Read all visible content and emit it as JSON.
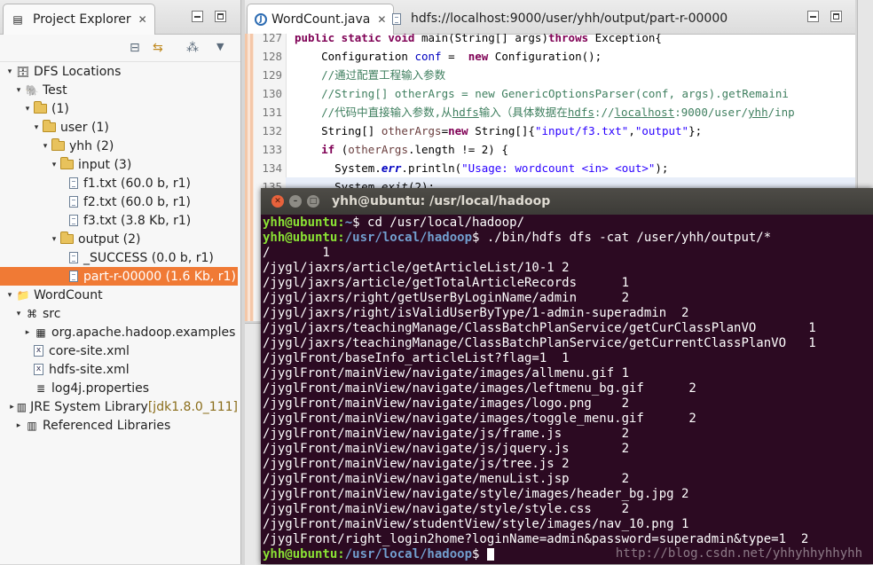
{
  "explorer": {
    "tab_title": "Project Explorer",
    "close_glyph": "✕",
    "tree": [
      {
        "label": "DFS Locations",
        "extra": "",
        "indent": 0,
        "twisty": "▾",
        "icon": "dfs-icon",
        "selected": false
      },
      {
        "label": "Test",
        "extra": "",
        "indent": 1,
        "twisty": "▾",
        "icon": "elephant-icon",
        "selected": false
      },
      {
        "label": "(1)",
        "extra": "",
        "indent": 2,
        "twisty": "▾",
        "icon": "folder-icon",
        "selected": false
      },
      {
        "label": "user (1)",
        "extra": "",
        "indent": 3,
        "twisty": "▾",
        "icon": "folder-icon",
        "selected": false
      },
      {
        "label": "yhh (2)",
        "extra": "",
        "indent": 4,
        "twisty": "▾",
        "icon": "folder-icon",
        "selected": false
      },
      {
        "label": "input (3)",
        "extra": "",
        "indent": 5,
        "twisty": "▾",
        "icon": "folder-icon",
        "selected": false
      },
      {
        "label": "f1.txt (60.0 b, r1)",
        "extra": "",
        "indent": 6,
        "twisty": "",
        "icon": "file-icon",
        "selected": false
      },
      {
        "label": "f2.txt (60.0 b, r1)",
        "extra": "",
        "indent": 6,
        "twisty": "",
        "icon": "file-icon",
        "selected": false
      },
      {
        "label": "f3.txt (3.8 Kb, r1)",
        "extra": "",
        "indent": 6,
        "twisty": "",
        "icon": "file-icon",
        "selected": false
      },
      {
        "label": "output (2)",
        "extra": "",
        "indent": 5,
        "twisty": "▾",
        "icon": "folder-icon",
        "selected": false
      },
      {
        "label": "_SUCCESS (0.0 b, r1)",
        "extra": "",
        "indent": 6,
        "twisty": "",
        "icon": "file-icon",
        "selected": false
      },
      {
        "label": "part-r-00000 (1.6 Kb, r1)",
        "extra": "",
        "indent": 6,
        "twisty": "",
        "icon": "file-icon",
        "selected": true
      },
      {
        "label": "WordCount",
        "extra": "",
        "indent": 0,
        "twisty": "▾",
        "icon": "project-icon",
        "selected": false
      },
      {
        "label": "src",
        "extra": "",
        "indent": 1,
        "twisty": "▾",
        "icon": "source-folder-icon",
        "selected": false
      },
      {
        "label": "org.apache.hadoop.examples",
        "extra": "",
        "indent": 2,
        "twisty": "▸",
        "icon": "package-icon",
        "selected": false
      },
      {
        "label": "core-site.xml",
        "extra": "",
        "indent": 2,
        "twisty": "",
        "icon": "xml-icon",
        "selected": false
      },
      {
        "label": "hdfs-site.xml",
        "extra": "",
        "indent": 2,
        "twisty": "",
        "icon": "xml-icon",
        "selected": false
      },
      {
        "label": "log4j.properties",
        "extra": "",
        "indent": 2,
        "twisty": "",
        "icon": "properties-icon",
        "selected": false
      },
      {
        "label": "JRE System Library",
        "extra": "[jdk1.8.0_111]",
        "indent": 1,
        "twisty": "▸",
        "icon": "library-icon",
        "selected": false
      },
      {
        "label": "Referenced Libraries",
        "extra": "",
        "indent": 1,
        "twisty": "▸",
        "icon": "library-icon",
        "selected": false
      }
    ]
  },
  "editor": {
    "tabs": [
      {
        "label": "WordCount.java",
        "close": "✕",
        "icon": "java-file-icon",
        "active": true
      },
      {
        "label": "hdfs://localhost:9000/user/yhh/output/part-r-00000",
        "close": "",
        "icon": "hdfs-file-icon",
        "active": false
      }
    ],
    "lines": [
      {
        "num": "127",
        "html": "<span style='color:#7f0055;font-weight:bold'>public static void</span> main(String[] args)<span style='color:#7f0055;font-weight:bold'>throws</span> Exception{"
      },
      {
        "num": "128",
        "html": "    Configuration <span style='color:#0000c0'>conf</span> =  <span style='color:#7f0055;font-weight:bold'>new</span> Configuration();"
      },
      {
        "num": "129",
        "html": "    <span style='color:#3f7f5f'>//通过配置工程输入参数</span>"
      },
      {
        "num": "130",
        "html": "    <span style='color:#3f7f5f'>//String[] otherArgs = new GenericOptionsParser(conf, args).getRemaini</span>"
      },
      {
        "num": "131",
        "html": "    <span style='color:#3f7f5f'>//代码中直接输入参数,从<u>hdfs</u>输入（具体数据在<u>hdfs</u>://<u>localhost</u>:9000/user/<u>yhh</u>/inp</span>"
      },
      {
        "num": "132",
        "html": "    String[] <span style='color:#6a3e3e'>otherArgs</span>=<span style='color:#7f0055;font-weight:bold'>new</span> String[]{<span style='color:#2a00ff'>\"input/f3.txt\"</span>,<span style='color:#2a00ff'>\"output\"</span>};"
      },
      {
        "num": "133",
        "html": "    <span style='color:#7f0055;font-weight:bold'>if</span> (<span style='color:#6a3e3e'>otherArgs</span>.length != 2) {"
      },
      {
        "num": "134",
        "html": "      System.<span style='color:#0000c0;font-weight:bold;font-style:italic'>err</span>.println(<span style='color:#2a00ff'>\"Usage: wordcount &lt;in&gt; &lt;out&gt;\"</span>);"
      },
      {
        "num": "135",
        "html": "      System.<span style='font-style:italic'>exit</span>(2);"
      }
    ]
  },
  "terminal": {
    "title": "yhh@ubuntu: /usr/local/hadoop",
    "prompt_user": "yhh@ubuntu",
    "lines": [
      {
        "path": "~",
        "cmd": " cd /usr/local/hadoop/",
        "text": ""
      },
      {
        "path": "/usr/local/hadoop",
        "cmd": " ./bin/hdfs dfs -cat /user/yhh/output/*",
        "text": ""
      },
      {
        "path": "",
        "cmd": "",
        "text": "/       1"
      },
      {
        "path": "",
        "cmd": "",
        "text": "/jygl/jaxrs/article/getArticleList/10-1 2"
      },
      {
        "path": "",
        "cmd": "",
        "text": "/jygl/jaxrs/article/getTotalArticleRecords      1"
      },
      {
        "path": "",
        "cmd": "",
        "text": "/jygl/jaxrs/right/getUserByLoginName/admin      2"
      },
      {
        "path": "",
        "cmd": "",
        "text": "/jygl/jaxrs/right/isValidUserByType/1-admin-superadmin  2"
      },
      {
        "path": "",
        "cmd": "",
        "text": "/jygl/jaxrs/teachingManage/ClassBatchPlanService/getCurClassPlanVO       1"
      },
      {
        "path": "",
        "cmd": "",
        "text": "/jygl/jaxrs/teachingManage/ClassBatchPlanService/getCurrentClassPlanVO   1"
      },
      {
        "path": "",
        "cmd": "",
        "text": "/jyglFront/baseInfo_articleList?flag=1  1"
      },
      {
        "path": "",
        "cmd": "",
        "text": "/jyglFront/mainView/navigate/images/allmenu.gif 1"
      },
      {
        "path": "",
        "cmd": "",
        "text": "/jyglFront/mainView/navigate/images/leftmenu_bg.gif      2"
      },
      {
        "path": "",
        "cmd": "",
        "text": "/jyglFront/mainView/navigate/images/logo.png    2"
      },
      {
        "path": "",
        "cmd": "",
        "text": "/jyglFront/mainView/navigate/images/toggle_menu.gif      2"
      },
      {
        "path": "",
        "cmd": "",
        "text": "/jyglFront/mainView/navigate/js/frame.js        2"
      },
      {
        "path": "",
        "cmd": "",
        "text": "/jyglFront/mainView/navigate/js/jquery.js       2"
      },
      {
        "path": "",
        "cmd": "",
        "text": "/jyglFront/mainView/navigate/js/tree.js 2"
      },
      {
        "path": "",
        "cmd": "",
        "text": "/jyglFront/mainView/navigate/menuList.jsp       2"
      },
      {
        "path": "",
        "cmd": "",
        "text": "/jyglFront/mainView/navigate/style/images/header_bg.jpg 2"
      },
      {
        "path": "",
        "cmd": "",
        "text": "/jyglFront/mainView/navigate/style/style.css    2"
      },
      {
        "path": "",
        "cmd": "",
        "text": "/jyglFront/mainView/studentView/style/images/nav_10.png 1"
      },
      {
        "path": "",
        "cmd": "",
        "text": "/jyglFront/right_login2home?loginName=admin&password=superadmin&type=1  2"
      },
      {
        "path": "/usr/local/hadoop",
        "cmd": " ",
        "text": "",
        "cursor": true
      }
    ],
    "watermark": "http://blog.csdn.net/yhhyhhyhhyhh"
  }
}
